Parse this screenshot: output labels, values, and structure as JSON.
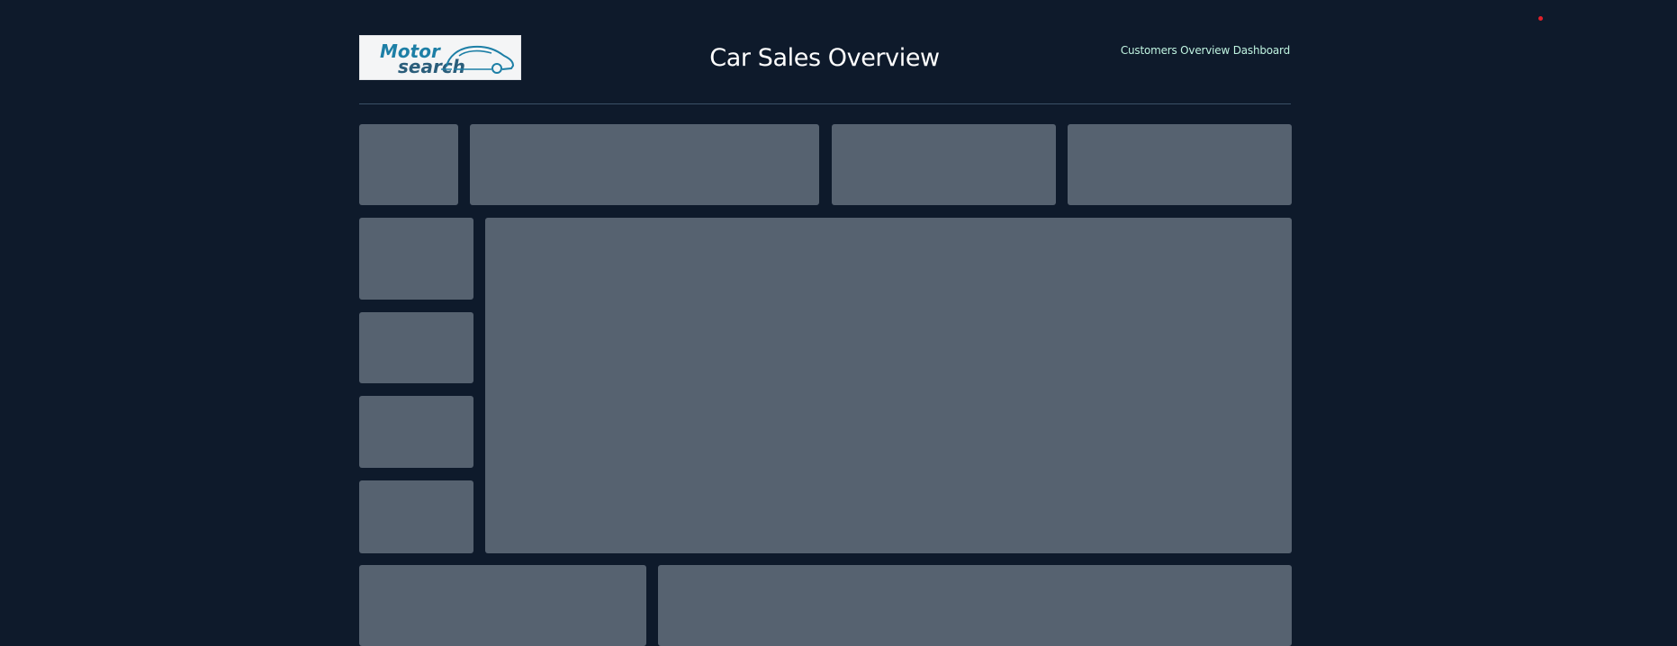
{
  "header": {
    "logo": {
      "word1": "Motor",
      "word2": "search",
      "icon": "car-outline-icon",
      "colors": {
        "primary": "#1d7fa6",
        "dark": "#2a3440"
      }
    },
    "title": "Car Sales Overview",
    "nav_link": "Customers Overview Dashboard"
  },
  "theme": {
    "background": "#0e1a2b",
    "panel": "#566270",
    "link": "#bff3e0",
    "divider": "#3a5166",
    "indicator": "#e0202a"
  }
}
